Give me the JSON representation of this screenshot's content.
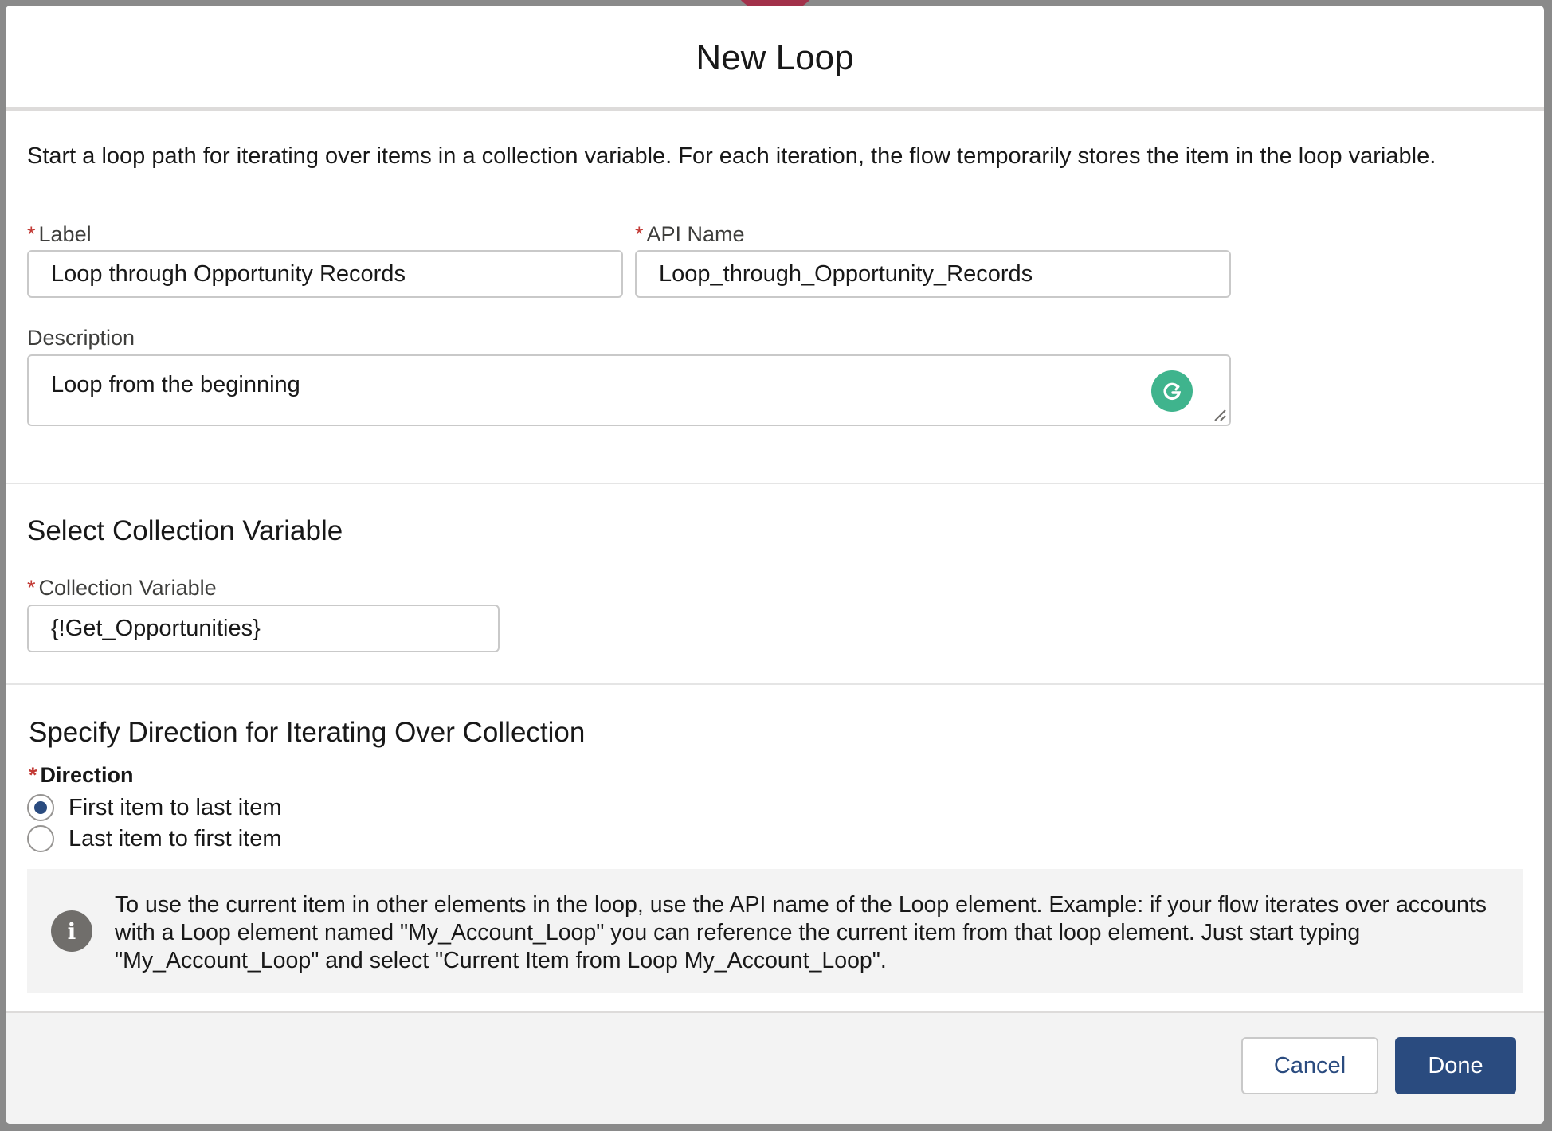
{
  "dialog": {
    "title": "New Loop",
    "intro": "Start a loop path for iterating over items in a collection variable. For each iteration, the flow temporarily stores the item in the loop variable."
  },
  "fields": {
    "label": {
      "label": "Label",
      "required_marker": "*",
      "value": "Loop through Opportunity Records"
    },
    "api_name": {
      "label": "API Name",
      "required_marker": "*",
      "value": "Loop_through_Opportunity_Records"
    },
    "description": {
      "label": "Description",
      "value": "Loop from the beginning"
    }
  },
  "collection_section": {
    "title": "Select Collection Variable",
    "field": {
      "label": "Collection Variable",
      "required_marker": "*",
      "value": "{!Get_Opportunities}"
    }
  },
  "direction_section": {
    "title": "Specify Direction for Iterating Over Collection",
    "label": "Direction",
    "required_marker": "*",
    "options": [
      {
        "label": "First item to last item",
        "selected": true
      },
      {
        "label": "Last item to first item",
        "selected": false
      }
    ]
  },
  "info": {
    "icon": "info-icon",
    "text": "To use the current item in other elements in the loop, use the API name of the Loop element. Example: if your flow iterates over accounts with a Loop element named \"My_Account_Loop\" you can reference the current item from that loop element. Just start typing \"My_Account_Loop\" and select \"Current Item from Loop My_Account_Loop\"."
  },
  "footer": {
    "cancel_label": "Cancel",
    "done_label": "Done"
  },
  "colors": {
    "brand_button": "#2a4b7f",
    "required": "#c23934",
    "grammarly": "#3fb48d"
  }
}
